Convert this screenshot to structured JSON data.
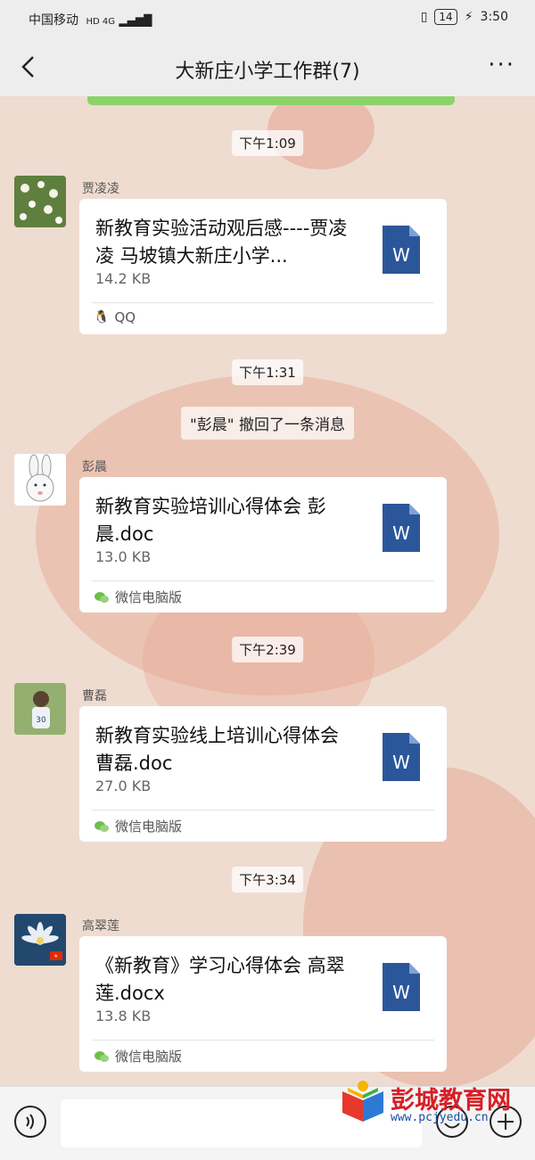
{
  "status": {
    "carrier": "中国移动",
    "network": "HD 4G",
    "battery": "14",
    "time": "3:50"
  },
  "nav": {
    "title": "大新庄小学工作群(7)",
    "more_label": "···"
  },
  "timestamps": [
    "下午1:09",
    "下午1:31",
    "下午2:39",
    "下午3:34"
  ],
  "system_message": "\"彭晨\" 撤回了一条消息",
  "messages": [
    {
      "sender": "贾凌凌",
      "file_name": "新教育实验活动观后感----贾凌凌 马坡镇大新庄小学...",
      "file_size": "14.2 KB",
      "source": "QQ",
      "source_icon": "qq-icon"
    },
    {
      "sender": "彭晨",
      "file_name": "新教育实验培训心得体会 彭晨.doc",
      "file_size": "13.0 KB",
      "source": "微信电脑版",
      "source_icon": "wechat-icon"
    },
    {
      "sender": "曹磊",
      "file_name": "新教育实验线上培训心得体会  曹磊.doc",
      "file_size": "27.0 KB",
      "source": "微信电脑版",
      "source_icon": "wechat-icon"
    },
    {
      "sender": "高翠莲",
      "file_name": "《新教育》学习心得体会  高翠莲.docx",
      "file_size": "13.8 KB",
      "source": "微信电脑版",
      "source_icon": "wechat-icon"
    }
  ],
  "file_icon_letter": "W",
  "watermark": {
    "name": "彭城教育网",
    "url": "www.pcjyedu.cn"
  },
  "colors": {
    "word_blue": "#2b579a",
    "background": "#efdcd0",
    "bar": "#ededed",
    "green": "#8bd36a"
  }
}
